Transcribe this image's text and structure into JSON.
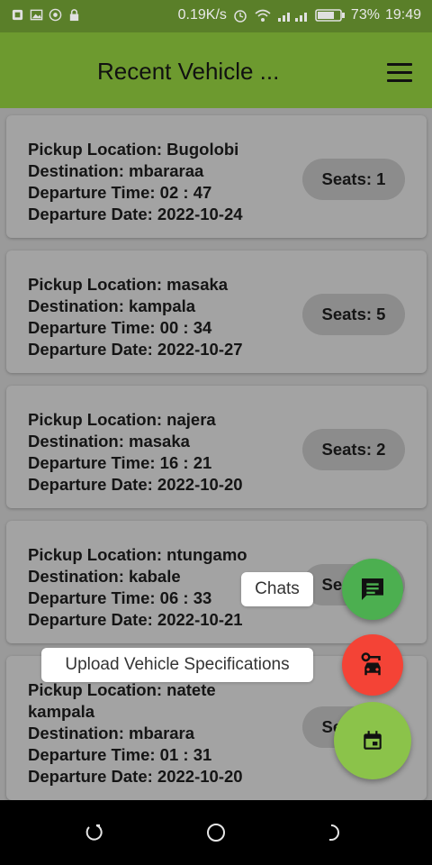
{
  "status_bar": {
    "speed": "0.19K/s",
    "battery": "73%",
    "time": "19:49",
    "icons": [
      "sim-icon",
      "gallery-icon",
      "whatsapp-icon",
      "lock-icon",
      "alarm-icon",
      "wifi-icon",
      "signal-icon",
      "battery-icon"
    ]
  },
  "app_bar": {
    "title": "Recent Vehicle ...",
    "menu_icon": "menu-icon",
    "color": "#6d9a2f"
  },
  "rides": [
    {
      "pickup": "Pickup Location: Bugolobi",
      "destination": "Destination: mbararaa",
      "time": "Departure Time: 02 : 47",
      "date": "Departure Date: 2022-10-24",
      "seats": "Seats: 1"
    },
    {
      "pickup": "Pickup Location: masaka",
      "destination": "Destination: kampala",
      "time": "Departure Time: 00 : 34",
      "date": "Departure Date: 2022-10-27",
      "seats": "Seats: 5"
    },
    {
      "pickup": "Pickup Location: najera",
      "destination": "Destination: masaka",
      "time": "Departure Time: 16 : 21",
      "date": "Departure Date: 2022-10-20",
      "seats": "Seats: 2"
    },
    {
      "pickup": "Pickup Location: ntungamo",
      "destination": "Destination: kabale",
      "time": "Departure Time: 06 : 33",
      "date": "Departure Date: 2022-10-21",
      "seats": "Seats: 3"
    },
    {
      "pickup": "Pickup Location: natete",
      "pickup_cont": "kampala",
      "destination": "Destination: mbarara",
      "time": "Departure Time: 01 : 31",
      "date": "Departure Date: 2022-10-20",
      "seats": "Seats: 4"
    }
  ],
  "fab_menu": {
    "chats_label": "Chats",
    "upload_label": "Upload Vehicle Specifications",
    "chats_color": "#4caf50",
    "upload_color": "#f44336",
    "main_color": "#8bc34a",
    "chats_icon": "chat-icon",
    "upload_icon": "car-key-icon",
    "main_icon": "calendar-icon"
  },
  "nav_bar": {
    "icons": [
      "recents-icon",
      "home-icon",
      "back-icon"
    ]
  }
}
